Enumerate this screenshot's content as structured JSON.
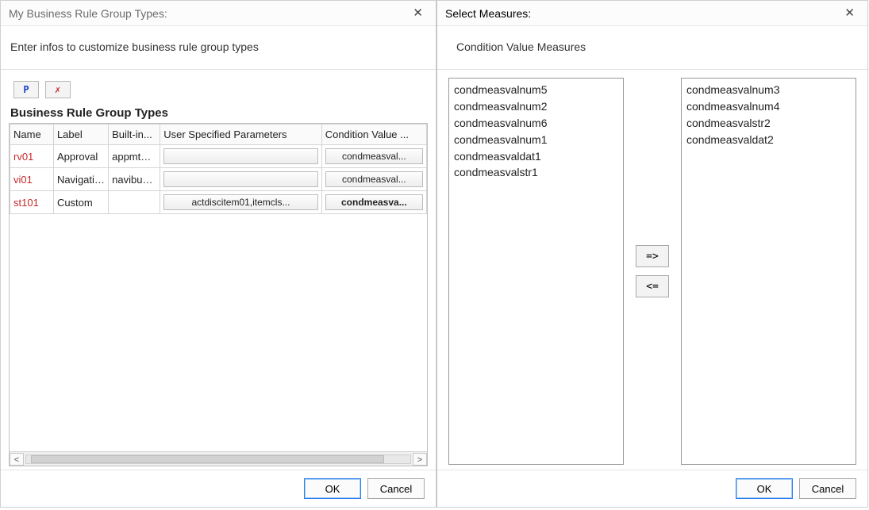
{
  "left": {
    "title": "My Business Rule Group Types:",
    "info": "Enter infos to customize business rule group types",
    "toolbar": {
      "add_glyph": "P",
      "delete_glyph": "✗"
    },
    "section_title": "Business Rule Group Types",
    "columns": {
      "name": "Name",
      "label": "Label",
      "builtin": "Built-in...",
      "user_spec": "User Specified Parameters",
      "cond_val": "Condition Value ..."
    },
    "rows": [
      {
        "name": "rv01",
        "label": "Approval",
        "builtin": "appmtho...",
        "user_spec": "",
        "cond_val": "condmeasval..."
      },
      {
        "name": "vi01",
        "label": "Navigation",
        "builtin": "navibuck...",
        "user_spec": "",
        "cond_val": "condmeasval..."
      },
      {
        "name": "st101",
        "label": "Custom",
        "builtin": "",
        "user_spec": "actdiscitem01,itemcls...",
        "cond_val": "condmeasva...",
        "cond_bold": true
      }
    ],
    "ok": "OK",
    "cancel": "Cancel",
    "scroll_left": "<",
    "scroll_right": ">"
  },
  "right": {
    "title": "Select Measures:",
    "subtitle": "Condition Value Measures",
    "available": [
      "condmeasvalnum5",
      "condmeasvalnum2",
      "condmeasvalnum6",
      "condmeasvalnum1",
      "condmeasvaldat1",
      "condmeasvalstr1"
    ],
    "selected": [
      "condmeasvalnum3",
      "condmeasvalnum4",
      "condmeasvalstr2",
      "condmeasvaldat2"
    ],
    "move_right": "=>",
    "move_left": "<=",
    "ok": "OK",
    "cancel": "Cancel"
  }
}
